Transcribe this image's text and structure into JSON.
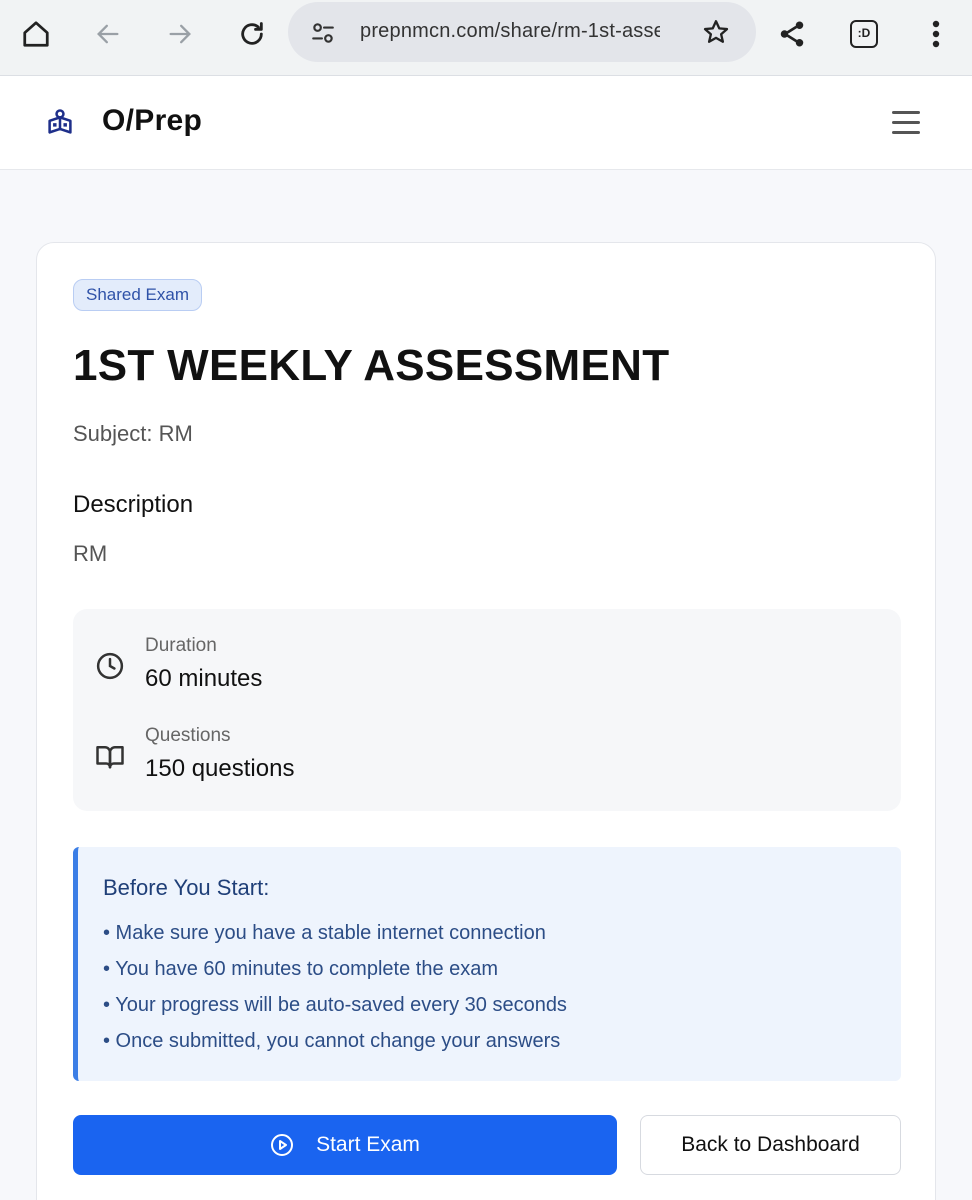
{
  "browser": {
    "url": "prepnmcn.com/share/rm-1st-asse",
    "icons": [
      "home-icon",
      "back-arrow-icon",
      "forward-arrow-icon",
      "reload-icon",
      "site-settings-icon",
      "bookmark-star-icon",
      "share-icon",
      "extension-icon",
      "more-vert-icon"
    ],
    "extension_label": ":D"
  },
  "app": {
    "brand": "O/Prep",
    "logo_icon": "school-icon",
    "menu_icon": "hamburger-icon"
  },
  "exam": {
    "badge": "Shared Exam",
    "title": "1ST WEEKLY ASSESSMENT",
    "subject": "Subject: RM",
    "description_heading": "Description",
    "description": "RM",
    "duration": {
      "label": "Duration",
      "value": "60 minutes",
      "icon": "clock-icon"
    },
    "questions": {
      "label": "Questions",
      "value": "150 questions",
      "icon": "book-icon"
    }
  },
  "notice": {
    "heading": "Before You Start:",
    "items": [
      "• Make sure you have a stable internet connection",
      "• You have 60 minutes to complete the exam",
      "• Your progress will be auto-saved every 30 seconds",
      "• Once submitted, you cannot change your answers"
    ]
  },
  "actions": {
    "start_label": "Start Exam",
    "back_label": "Back to Dashboard"
  },
  "colors": {
    "primary": "#1a64f0",
    "notice_bg": "#eef4fd",
    "notice_border": "#3b7ee6",
    "badge_bg": "#e3ecfb",
    "brand_icon": "#1e2f8a"
  }
}
